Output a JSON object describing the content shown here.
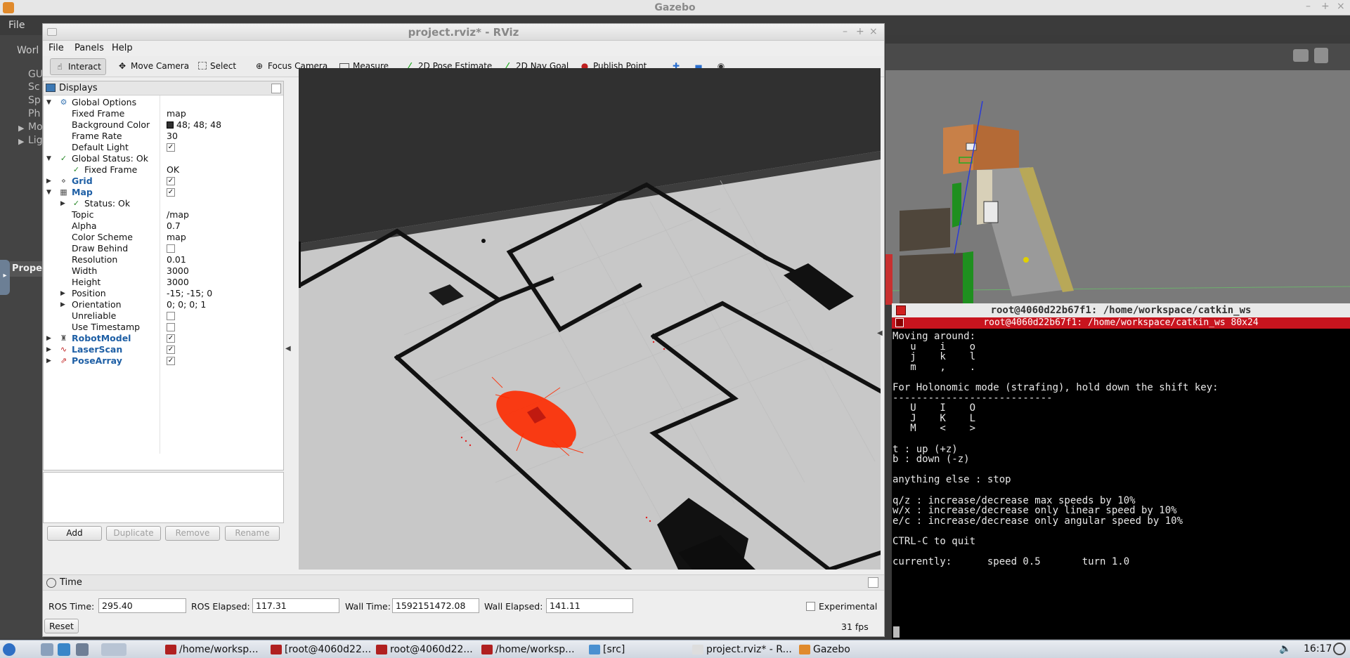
{
  "gazebo": {
    "title": "Gazebo",
    "menu_file": "File",
    "left_items": [
      "GU",
      "Sc",
      "Sp",
      "Ph",
      "Mo",
      "Lig"
    ],
    "world_tab": "Worl",
    "properties_label": "Prope"
  },
  "rviz": {
    "title": "project.rviz* - RViz",
    "menu": {
      "file": "File",
      "panels": "Panels",
      "help": "Help"
    },
    "tools": {
      "interact": "Interact",
      "move_camera": "Move Camera",
      "select": "Select",
      "focus_camera": "Focus Camera",
      "measure": "Measure",
      "pose_estimate": "2D Pose Estimate",
      "nav_goal": "2D Nav Goal",
      "publish_point": "Publish Point"
    },
    "displays": {
      "title": "Displays",
      "rows": {
        "global_options": "Global Options",
        "fixed_frame": {
          "name": "Fixed Frame",
          "value": "map"
        },
        "background_color": {
          "name": "Background Color",
          "value": "48; 48; 48"
        },
        "frame_rate": {
          "name": "Frame Rate",
          "value": "30"
        },
        "default_light": {
          "name": "Default Light",
          "checked": true
        },
        "global_status": "Global Status: Ok",
        "fixed_frame_status": {
          "name": "Fixed Frame",
          "value": "OK"
        },
        "grid": {
          "name": "Grid",
          "checked": true
        },
        "map": {
          "name": "Map",
          "checked": true
        },
        "status": "Status: Ok",
        "topic": {
          "name": "Topic",
          "value": "/map"
        },
        "alpha": {
          "name": "Alpha",
          "value": "0.7"
        },
        "color_scheme": {
          "name": "Color Scheme",
          "value": "map"
        },
        "draw_behind": {
          "name": "Draw Behind",
          "checked": false
        },
        "resolution": {
          "name": "Resolution",
          "value": "0.01"
        },
        "width": {
          "name": "Width",
          "value": "3000"
        },
        "height": {
          "name": "Height",
          "value": "3000"
        },
        "position": {
          "name": "Position",
          "value": "-15; -15; 0"
        },
        "orientation": {
          "name": "Orientation",
          "value": "0; 0; 0; 1"
        },
        "unreliable": {
          "name": "Unreliable",
          "checked": false
        },
        "use_timestamp": {
          "name": "Use Timestamp",
          "checked": false
        },
        "robot_model": {
          "name": "RobotModel",
          "checked": true
        },
        "laser_scan": {
          "name": "LaserScan",
          "checked": true
        },
        "pose_array": {
          "name": "PoseArray",
          "checked": true
        }
      },
      "buttons": {
        "add": "Add",
        "duplicate": "Duplicate",
        "remove": "Remove",
        "rename": "Rename"
      }
    },
    "time": {
      "title": "Time",
      "ros_time_label": "ROS Time:",
      "ros_time": "295.40",
      "ros_elapsed_label": "ROS Elapsed:",
      "ros_elapsed": "117.31",
      "wall_time_label": "Wall Time:",
      "wall_time": "1592151472.08",
      "wall_elapsed_label": "Wall Elapsed:",
      "wall_elapsed": "141.11",
      "experimental": "Experimental",
      "experimental_checked": false,
      "reset": "Reset",
      "fps": "31 fps"
    }
  },
  "terminal": {
    "title": "root@4060d22b67f1: /home/workspace/catkin_ws",
    "tab": "root@4060d22b67f1: /home/workspace/catkin_ws 80x24",
    "lines": [
      "Moving around:",
      "   u    i    o",
      "   j    k    l",
      "   m    ,    .",
      "",
      "For Holonomic mode (strafing), hold down the shift key:",
      "---------------------------",
      "   U    I    O",
      "   J    K    L",
      "   M    <    >",
      "",
      "t : up (+z)",
      "b : down (-z)",
      "",
      "anything else : stop",
      "",
      "q/z : increase/decrease max speeds by 10%",
      "w/x : increase/decrease only linear speed by 10%",
      "e/c : increase/decrease only angular speed by 10%",
      "",
      "CTRL-C to quit",
      "",
      "currently:      speed 0.5       turn 1.0"
    ]
  },
  "taskbar": {
    "tasks": [
      "/home/worksp...",
      "[root@4060d22...",
      "root@4060d22...",
      "/home/worksp...",
      "[src]",
      "project.rviz* - R...",
      "Gazebo"
    ],
    "clock": "16:17"
  }
}
